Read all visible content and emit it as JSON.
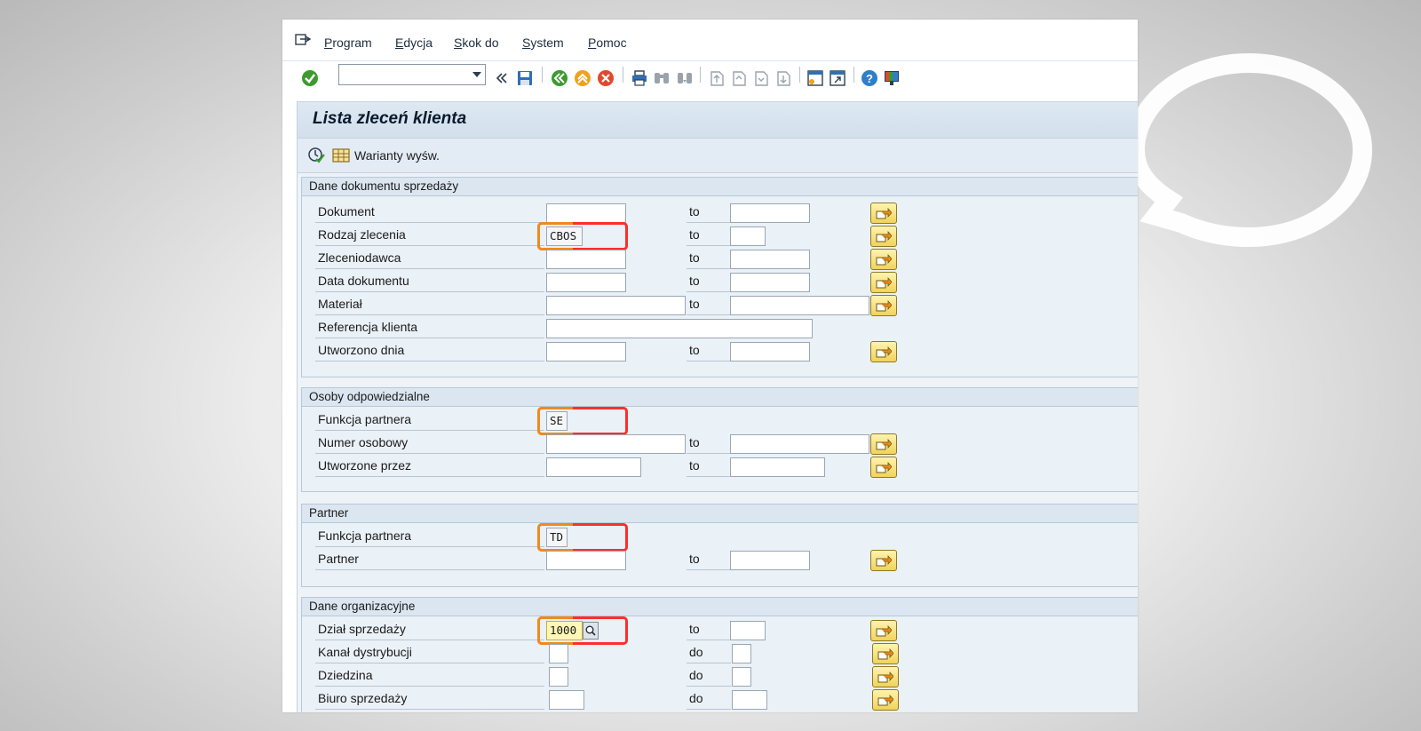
{
  "menu": {
    "items": [
      "Program",
      "Edycja",
      "Skok do",
      "System",
      "Pomoc"
    ]
  },
  "toolbar": {
    "command_field_value": "",
    "icons": [
      "enter-icon",
      "command-field",
      "back-double-icon",
      "save-icon",
      "back-icon",
      "exit-icon",
      "cancel-icon",
      "print-icon",
      "find-icon",
      "find-next-icon",
      "first-page-icon",
      "previous-page-icon",
      "next-page-icon",
      "last-page-icon",
      "new-session-icon",
      "shortcut-icon",
      "help-icon",
      "customize-layout-icon"
    ]
  },
  "page": {
    "title": "Lista zleceń klienta",
    "variant_label": "Warianty wyśw."
  },
  "groups": {
    "sales_doc": {
      "title": "Dane dokumentu sprzedaży",
      "rows": [
        {
          "label": "Dokument",
          "value": "",
          "to": "to",
          "to_value": ""
        },
        {
          "label": "Rodzaj zlecenia",
          "value": "CBOS",
          "to": "to",
          "to_value": ""
        },
        {
          "label": "Zleceniodawca",
          "value": "",
          "to": "to",
          "to_value": ""
        },
        {
          "label": "Data dokumentu",
          "value": "",
          "to": "to",
          "to_value": ""
        },
        {
          "label": "Materiał",
          "value": "",
          "to": "to",
          "to_value": ""
        },
        {
          "label": "Referencja klienta",
          "value": ""
        },
        {
          "label": "Utworzono dnia",
          "value": "",
          "to": "to",
          "to_value": ""
        }
      ]
    },
    "responsible": {
      "title": "Osoby odpowiedzialne",
      "rows": [
        {
          "label": "Funkcja partnera",
          "value": "SE"
        },
        {
          "label": "Numer osobowy",
          "value": "",
          "to": "to",
          "to_value": ""
        },
        {
          "label": "Utworzone przez",
          "value": "",
          "to": "to",
          "to_value": ""
        }
      ]
    },
    "partner": {
      "title": "Partner",
      "rows": [
        {
          "label": "Funkcja partnera",
          "value": "TD"
        },
        {
          "label": "Partner",
          "value": "",
          "to": "to",
          "to_value": ""
        }
      ]
    },
    "org": {
      "title": "Dane organizacyjne",
      "rows": [
        {
          "label": "Dział sprzedaży",
          "value": "1000",
          "to": "to",
          "to_value": ""
        },
        {
          "label": "Kanał dystrybucji",
          "value": "",
          "to": "do",
          "to_value": ""
        },
        {
          "label": "Dziedzina",
          "value": "",
          "to": "do",
          "to_value": ""
        },
        {
          "label": "Biuro sprzedaży",
          "value": "",
          "to": "do",
          "to_value": ""
        }
      ]
    }
  },
  "colors": {
    "highlight_red": "#ff2d2d",
    "highlight_orange": "#f08a1c",
    "sap_background": "#eef3f8",
    "multiple_selection_yellow": "#f1d35b"
  }
}
